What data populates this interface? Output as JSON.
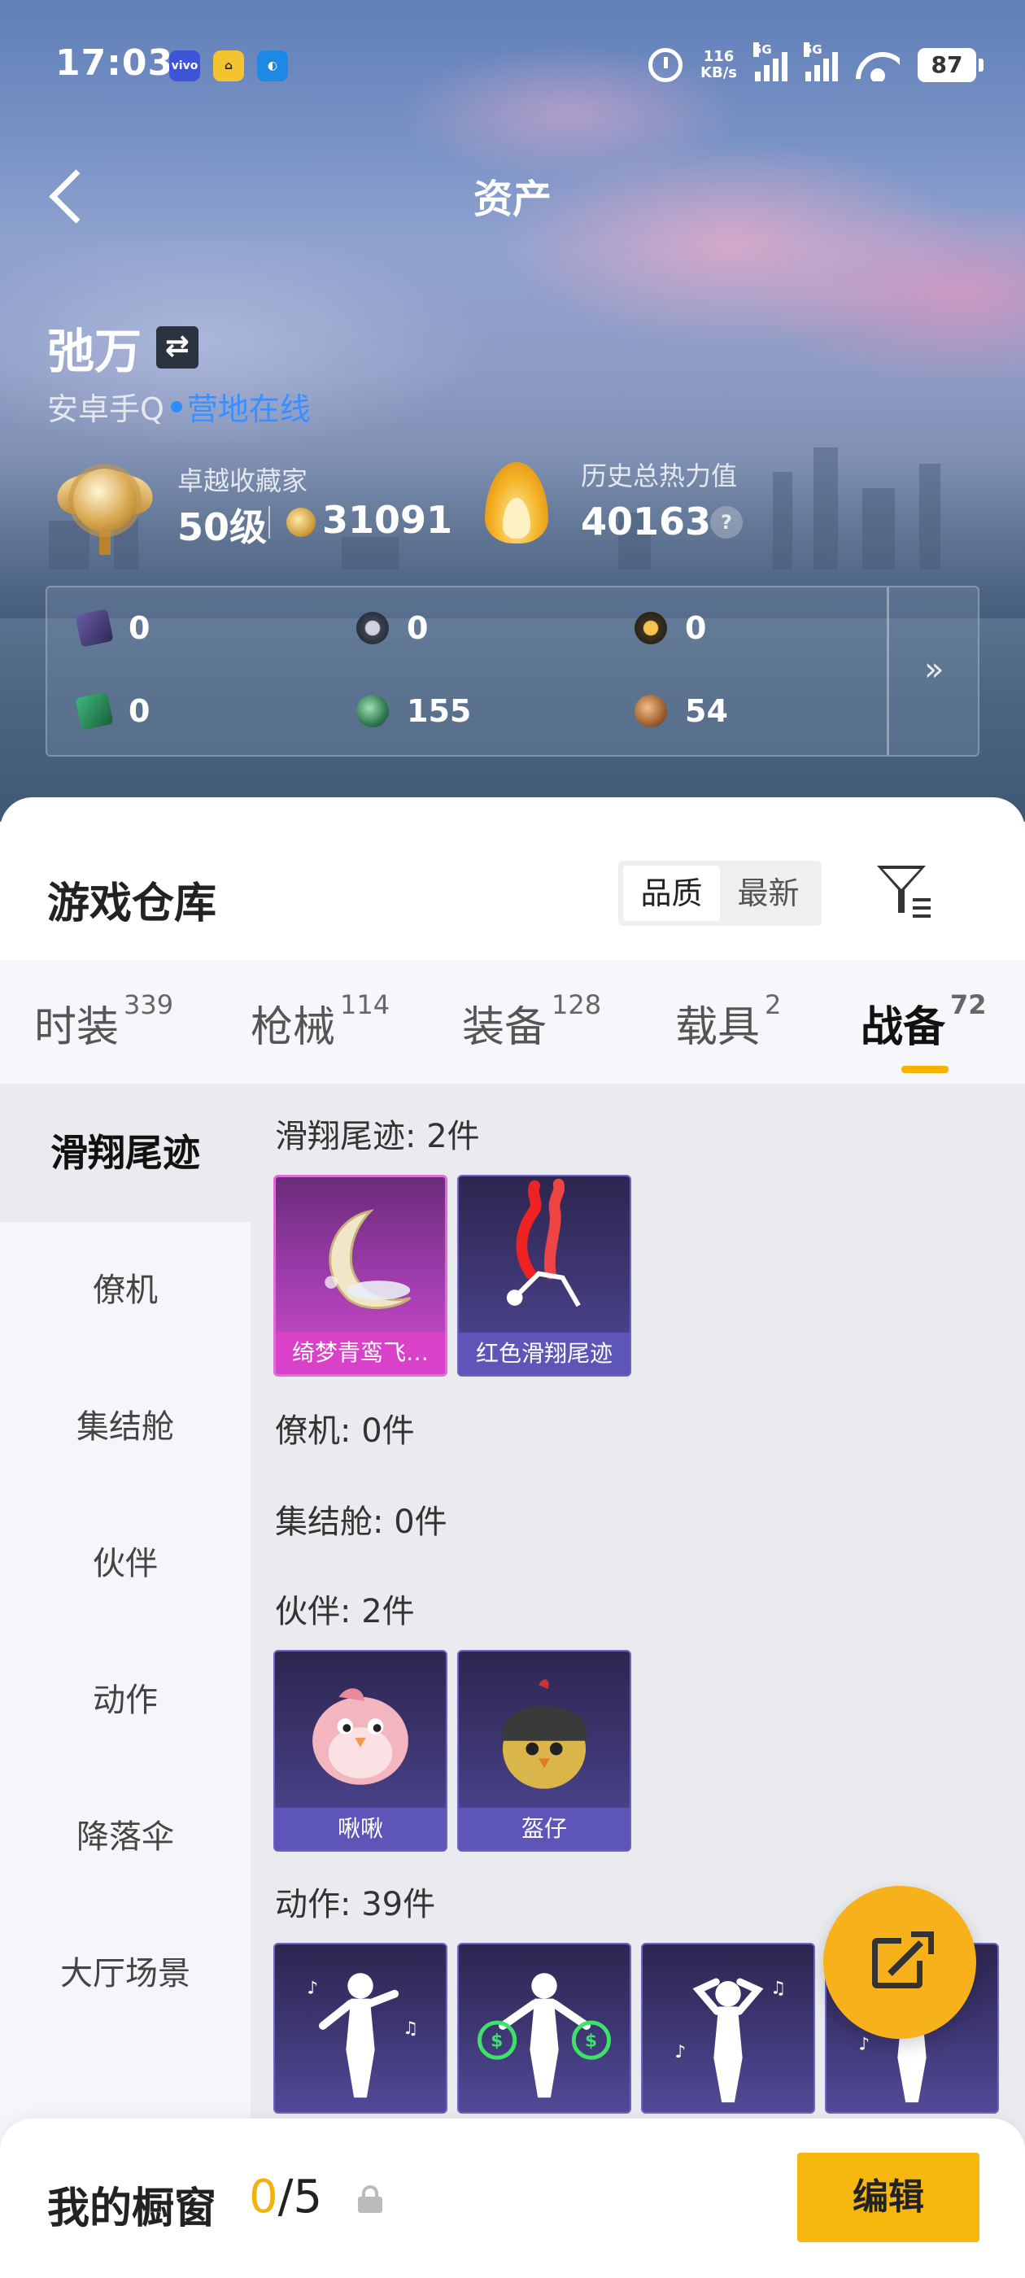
{
  "status_bar": {
    "time": "17:03",
    "speed_value": "116",
    "speed_unit": "KB/s",
    "net1": "5G",
    "net2": "5G",
    "battery": "87"
  },
  "nav": {
    "title": "资产"
  },
  "profile": {
    "name": "弛万",
    "platform": "安卓手Q",
    "online_status": "营地在线",
    "collector_title": "卓越收藏家",
    "level": "50级",
    "collector_points": "31091",
    "heat_label": "历史总热力值",
    "heat_value": "40163",
    "help": "?"
  },
  "currencies": [
    {
      "icon": "purple-card-icon",
      "value": "0"
    },
    {
      "icon": "silver-coin-icon",
      "value": "0"
    },
    {
      "icon": "gold-coin-icon",
      "value": "0"
    },
    {
      "icon": "green-card-icon",
      "value": "0"
    },
    {
      "icon": "green-orb-icon",
      "value": "155"
    },
    {
      "icon": "bronze-orb-icon",
      "value": "54"
    }
  ],
  "currency_more": "»",
  "warehouse": {
    "title": "游戏仓库",
    "sort_options": [
      "品质",
      "最新"
    ],
    "sort_selected": "品质"
  },
  "tabs": [
    {
      "label": "时装",
      "count": "339"
    },
    {
      "label": "枪械",
      "count": "114"
    },
    {
      "label": "装备",
      "count": "128"
    },
    {
      "label": "载具",
      "count": "2"
    },
    {
      "label": "战备",
      "count": "72"
    }
  ],
  "active_tab": "战备",
  "sidebar": [
    "滑翔尾迹",
    "僚机",
    "集结舱",
    "伙伴",
    "动作",
    "降落伞",
    "大厅场景"
  ],
  "sections": {
    "glide": {
      "header": "滑翔尾迹: 2件",
      "items": [
        "绮梦青鸾飞…",
        "红色滑翔尾迹"
      ]
    },
    "wingman": {
      "header": "僚机: 0件"
    },
    "capsule": {
      "header": "集结舱: 0件"
    },
    "partner": {
      "header": "伙伴: 2件",
      "items": [
        "啾啾",
        "盔仔"
      ]
    },
    "action": {
      "header": "动作: 39件"
    }
  },
  "showcase": {
    "title": "我的橱窗",
    "count_current": "0",
    "count_total": "/5",
    "edit_label": "编辑"
  },
  "colors": {
    "accent": "#f6b80e",
    "online_blue": "#3a8fff",
    "rare_pink": "#d941c8",
    "epic_purple": "#5e55b8"
  }
}
